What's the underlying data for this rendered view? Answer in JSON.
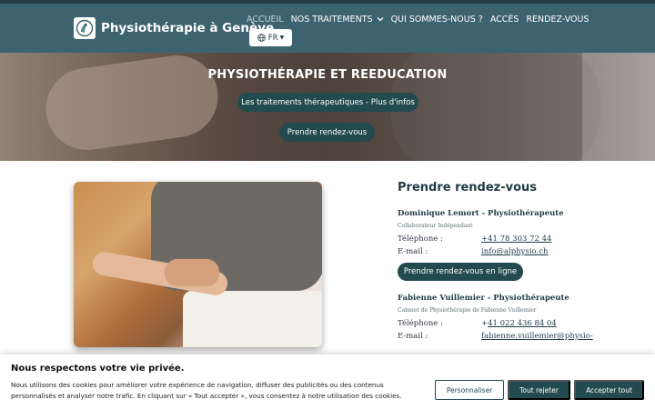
{
  "header": {
    "site_title": "Physiothérapie à Genève",
    "nav": [
      {
        "label": "ACCUEIL",
        "active": true
      },
      {
        "label": "NOS TRAITEMENTS",
        "has_dropdown": true
      },
      {
        "label": "QUI SOMMES-NOUS ?"
      },
      {
        "label": "ACCÈS"
      },
      {
        "label": "RENDEZ-VOUS"
      }
    ],
    "language": "FR"
  },
  "hero": {
    "title": "PHYSIOTHÉRAPIE ET REEDUCATION",
    "info_button": "Les traitements thérapeutiques - Plus d'infos",
    "appointment_button": "Prendre rendez-vous"
  },
  "appointment": {
    "title": "Prendre rendez-vous",
    "people": [
      {
        "name": "Dominique Lemort - Physiothérapeute",
        "subtitle": "Collaborateur Indépendant",
        "phone_label": "Téléphone :",
        "phone": "+41 78 303 72 44",
        "email_label": "E-mail :",
        "email": "info@alphysio.ch",
        "online_button": "Prendre rendez-vous en ligne"
      },
      {
        "name": "Fabienne Vuillemier - Physiothérapeute",
        "subtitle": "Cabinet de Physiothérapie de Fabienne Vuillemier",
        "phone_label": "Téléphone :",
        "phone_prefix": "+",
        "phone": "41 022 436 84 04",
        "email_label": "E-mail :",
        "email": "fabienne.vuillemier@physio-"
      }
    ]
  },
  "cookie": {
    "title": "Nous respectons votre vie privée.",
    "text": "Nous utilisons des cookies pour améliorer votre expérience de navigation, diffuser des publicités ou des contenus personnalisés et analyser notre trafic. En cliquant sur « Tout accepter », vous consentez à notre utilisation des cookies.",
    "customize_label": "Personnaliser",
    "reject_label": "Tout rejeter",
    "accept_label": "Accepter tout"
  },
  "colors": {
    "header_bg": "#3d6370",
    "accent": "#234a4f"
  }
}
